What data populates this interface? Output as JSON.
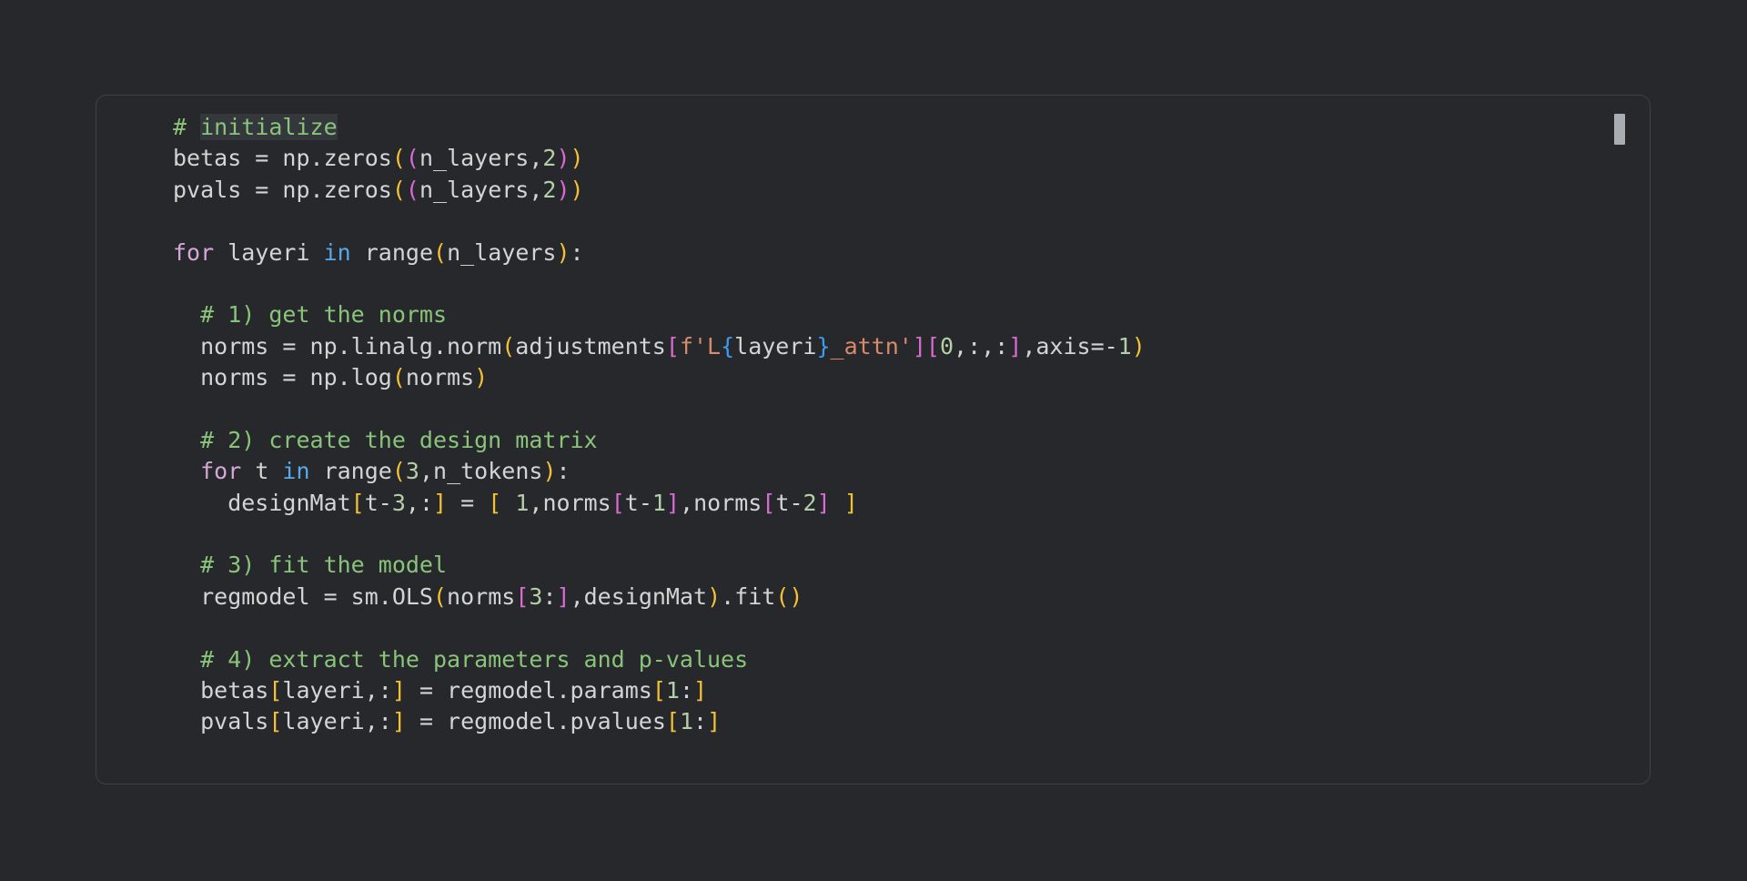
{
  "colors": {
    "background": "#26282b",
    "cell_border": "#3d4045",
    "default_text": "#d4d4d4",
    "comment": "#89c47a",
    "keyword": "#d4a7d8",
    "keyword_in": "#59a8e8",
    "number": "#b5cea8",
    "bracket_level1": "#f3c234",
    "bracket_level2": "#d96bd2",
    "bracket_level3": "#3e9cf0",
    "string": "#d98a6a"
  },
  "cell": {
    "marker_icon": "cell-selection-marker-icon",
    "lines": [
      [
        [
          "comment",
          "# "
        ],
        [
          "hl",
          "initialize"
        ]
      ],
      [
        [
          "plain",
          "betas = np.zeros"
        ],
        [
          "b1",
          "("
        ],
        [
          "b2",
          "("
        ],
        [
          "plain",
          "n_layers,"
        ],
        [
          "num",
          "2"
        ],
        [
          "b2",
          ")"
        ],
        [
          "b1",
          ")"
        ]
      ],
      [
        [
          "plain",
          "pvals = np.zeros"
        ],
        [
          "b1",
          "("
        ],
        [
          "b2",
          "("
        ],
        [
          "plain",
          "n_layers,"
        ],
        [
          "num",
          "2"
        ],
        [
          "b2",
          ")"
        ],
        [
          "b1",
          ")"
        ]
      ],
      [],
      [
        [
          "kw",
          "for"
        ],
        [
          "plain",
          " layeri "
        ],
        [
          "kwin",
          "in"
        ],
        [
          "plain",
          " range"
        ],
        [
          "b1",
          "("
        ],
        [
          "plain",
          "n_layers"
        ],
        [
          "b1",
          ")"
        ],
        [
          "plain",
          ":"
        ]
      ],
      [],
      [
        [
          "plain",
          "  "
        ],
        [
          "comment",
          "# 1) get the norms"
        ]
      ],
      [
        [
          "plain",
          "  norms = np.linalg.norm"
        ],
        [
          "b1",
          "("
        ],
        [
          "plain",
          "adjustments"
        ],
        [
          "b2",
          "["
        ],
        [
          "str",
          "f'L"
        ],
        [
          "b3",
          "{"
        ],
        [
          "plain",
          "layeri"
        ],
        [
          "b3",
          "}"
        ],
        [
          "str",
          "_attn'"
        ],
        [
          "b2",
          "]"
        ],
        [
          "b2",
          "["
        ],
        [
          "num",
          "0"
        ],
        [
          "plain",
          ",:,:"
        ],
        [
          "b2",
          "]"
        ],
        [
          "plain",
          ",axis=-"
        ],
        [
          "num",
          "1"
        ],
        [
          "b1",
          ")"
        ]
      ],
      [
        [
          "plain",
          "  norms = np.log"
        ],
        [
          "b1",
          "("
        ],
        [
          "plain",
          "norms"
        ],
        [
          "b1",
          ")"
        ]
      ],
      [],
      [
        [
          "plain",
          "  "
        ],
        [
          "comment",
          "# 2) create the design matrix"
        ]
      ],
      [
        [
          "plain",
          "  "
        ],
        [
          "kw",
          "for"
        ],
        [
          "plain",
          " t "
        ],
        [
          "kwin",
          "in"
        ],
        [
          "plain",
          " range"
        ],
        [
          "b1",
          "("
        ],
        [
          "num",
          "3"
        ],
        [
          "plain",
          ",n_tokens"
        ],
        [
          "b1",
          ")"
        ],
        [
          "plain",
          ":"
        ]
      ],
      [
        [
          "plain",
          "    designMat"
        ],
        [
          "b1",
          "["
        ],
        [
          "plain",
          "t-"
        ],
        [
          "num",
          "3"
        ],
        [
          "plain",
          ",:"
        ],
        [
          "b1",
          "]"
        ],
        [
          "plain",
          " = "
        ],
        [
          "b1",
          "["
        ],
        [
          "plain",
          " "
        ],
        [
          "num",
          "1"
        ],
        [
          "plain",
          ",norms"
        ],
        [
          "b2",
          "["
        ],
        [
          "plain",
          "t-"
        ],
        [
          "num",
          "1"
        ],
        [
          "b2",
          "]"
        ],
        [
          "plain",
          ",norms"
        ],
        [
          "b2",
          "["
        ],
        [
          "plain",
          "t-"
        ],
        [
          "num",
          "2"
        ],
        [
          "b2",
          "]"
        ],
        [
          "plain",
          " "
        ],
        [
          "b1",
          "]"
        ]
      ],
      [],
      [
        [
          "plain",
          "  "
        ],
        [
          "comment",
          "# 3) fit the model"
        ]
      ],
      [
        [
          "plain",
          "  regmodel = sm.OLS"
        ],
        [
          "b1",
          "("
        ],
        [
          "plain",
          "norms"
        ],
        [
          "b2",
          "["
        ],
        [
          "num",
          "3"
        ],
        [
          "plain",
          ":"
        ],
        [
          "b2",
          "]"
        ],
        [
          "plain",
          ",designMat"
        ],
        [
          "b1",
          ")"
        ],
        [
          "plain",
          ".fit"
        ],
        [
          "b1",
          "()"
        ]
      ],
      [],
      [
        [
          "plain",
          "  "
        ],
        [
          "comment",
          "# 4) extract the parameters and p-values"
        ]
      ],
      [
        [
          "plain",
          "  betas"
        ],
        [
          "b1",
          "["
        ],
        [
          "plain",
          "layeri,:"
        ],
        [
          "b1",
          "]"
        ],
        [
          "plain",
          " = regmodel.params"
        ],
        [
          "b1",
          "["
        ],
        [
          "num",
          "1"
        ],
        [
          "plain",
          ":"
        ],
        [
          "b1",
          "]"
        ]
      ],
      [
        [
          "plain",
          "  pvals"
        ],
        [
          "b1",
          "["
        ],
        [
          "plain",
          "layeri,:"
        ],
        [
          "b1",
          "]"
        ],
        [
          "plain",
          " = regmodel.pvalues"
        ],
        [
          "b1",
          "["
        ],
        [
          "num",
          "1"
        ],
        [
          "plain",
          ":"
        ],
        [
          "b1",
          "]"
        ]
      ]
    ]
  }
}
